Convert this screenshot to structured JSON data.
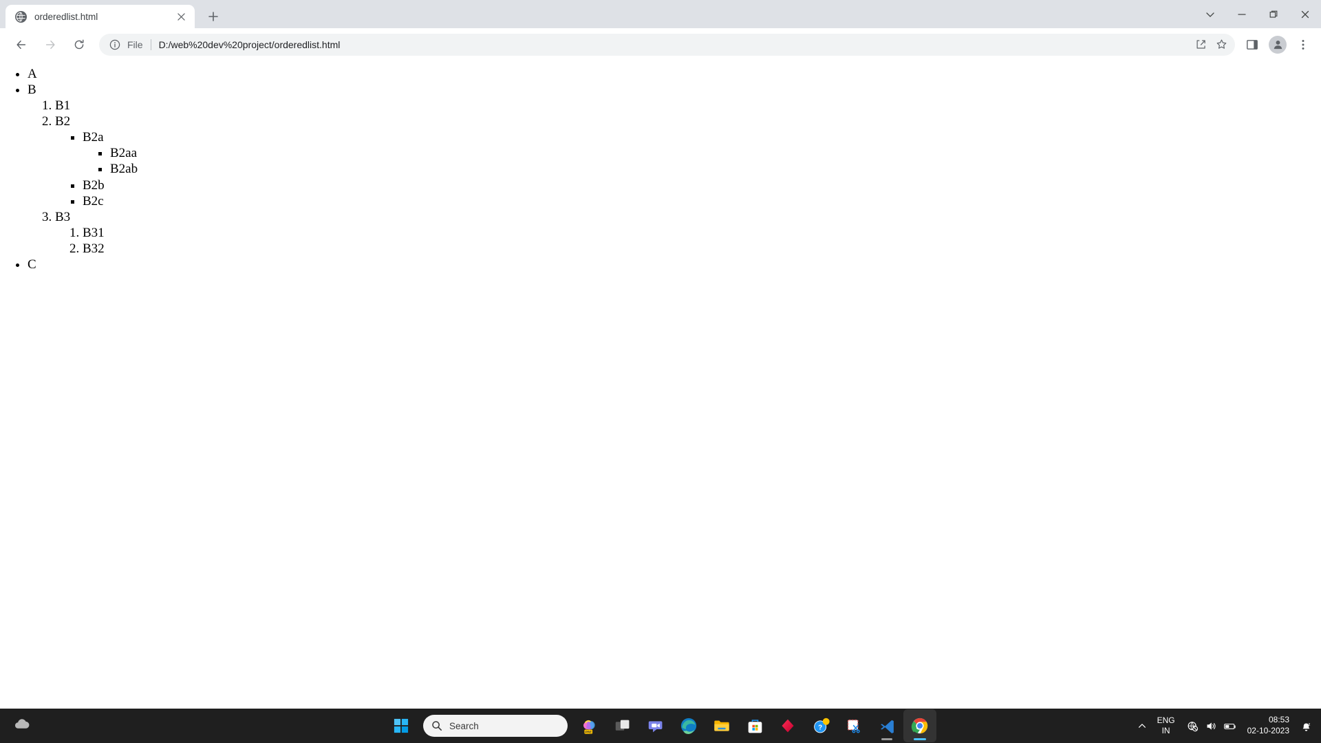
{
  "browser": {
    "tab": {
      "title": "orderedlist.html",
      "favicon_icon": "globe-icon",
      "close_icon": "close-icon"
    },
    "new_tab_icon": "plus-icon",
    "window_controls": {
      "search_tabs_icon": "chevron-down-icon",
      "minimize_icon": "minimize-icon",
      "maximize_icon": "restore-icon",
      "close_icon": "close-icon"
    },
    "toolbar": {
      "back_icon": "arrow-left-icon",
      "forward_icon": "arrow-right-icon",
      "reload_icon": "reload-icon",
      "share_icon": "share-icon",
      "bookmark_icon": "star-icon",
      "side_panel_icon": "side-panel-icon",
      "profile_icon": "person-icon",
      "menu_icon": "three-dots-icon"
    },
    "omnibox": {
      "info_icon": "info-circle-icon",
      "scheme_label": "File",
      "url": "D:/web%20dev%20project/orderedlist.html"
    }
  },
  "page": {
    "list": [
      {
        "label": "A",
        "children": []
      },
      {
        "label": "B",
        "ordered_children": [
          {
            "label": "B1",
            "children": []
          },
          {
            "label": "B2",
            "children": [
              {
                "label": "B2a",
                "children": [
                  {
                    "label": "B2aa"
                  },
                  {
                    "label": "B2ab"
                  }
                ]
              },
              {
                "label": "B2b",
                "children": []
              },
              {
                "label": "B2c",
                "children": []
              }
            ]
          },
          {
            "label": "B3",
            "ordered_children": [
              {
                "label": "B31"
              },
              {
                "label": "B32"
              }
            ]
          }
        ]
      },
      {
        "label": "C",
        "children": []
      }
    ]
  },
  "taskbar": {
    "weather_icon": "weather-icon",
    "start_icon": "windows-start-icon",
    "search": {
      "icon": "search-icon",
      "placeholder": "Search"
    },
    "apps": [
      {
        "name": "copilot-preview-icon",
        "label": "PRE",
        "running": false
      },
      {
        "name": "task-view-icon",
        "running": false
      },
      {
        "name": "teams-icon",
        "running": false
      },
      {
        "name": "edge-icon",
        "running": false
      },
      {
        "name": "file-explorer-icon",
        "running": false
      },
      {
        "name": "microsoft-store-icon",
        "running": false
      },
      {
        "name": "adobe-icon",
        "running": false
      },
      {
        "name": "get-help-icon",
        "running": false
      },
      {
        "name": "snipping-tool-icon",
        "running": false
      },
      {
        "name": "vs-code-icon",
        "running": true
      },
      {
        "name": "google-chrome-icon",
        "running": true,
        "active": true
      }
    ],
    "tray": {
      "overflow_icon": "chevron-up-icon",
      "language_line1": "ENG",
      "language_line2": "IN",
      "network_icon": "globe-blocked-icon",
      "volume_icon": "speaker-icon",
      "battery_icon": "battery-icon",
      "time": "08:53",
      "date": "02-10-2023",
      "notification_icon": "bell-silent-icon"
    }
  }
}
